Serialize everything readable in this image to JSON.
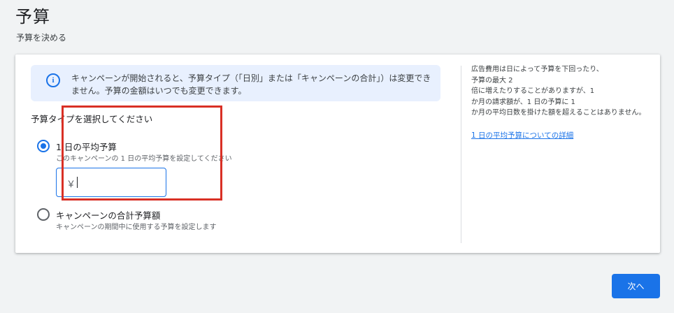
{
  "header": {
    "title": "予算",
    "subtitle": "予算を決める"
  },
  "info_banner": {
    "icon": "info-icon",
    "text": "キャンペーンが開始されると、予算タイプ（「日別」または「キャンペーンの合計」）は変更できません。予算の金額はいつでも変更できます。"
  },
  "budget_type": {
    "heading": "予算タイプを選択してください",
    "options": [
      {
        "label": "1 日の平均予算",
        "description": "このキャンペーンの 1 日の平均予算を設定してください",
        "selected": true
      },
      {
        "label": "キャンペーンの合計予算額",
        "description": "キャンペーンの期間中に使用する予算を設定します",
        "selected": false
      }
    ],
    "amount_input": {
      "prefix": "￥",
      "value": ""
    }
  },
  "help_panel": {
    "text": "広告費用は日によって予算を下回ったり、\n予算の最大 2\n倍に増えたりすることがありますが、1\nか月の請求額が、1 日の予算に 1\nか月の平均日数を掛けた額を超えることはありません。",
    "link": "1 日の平均予算についての詳細"
  },
  "footer": {
    "next_label": "次へ"
  },
  "colors": {
    "accent": "#1a73e8",
    "highlight": "#d93025",
    "banner_bg": "#e8f0fe"
  }
}
